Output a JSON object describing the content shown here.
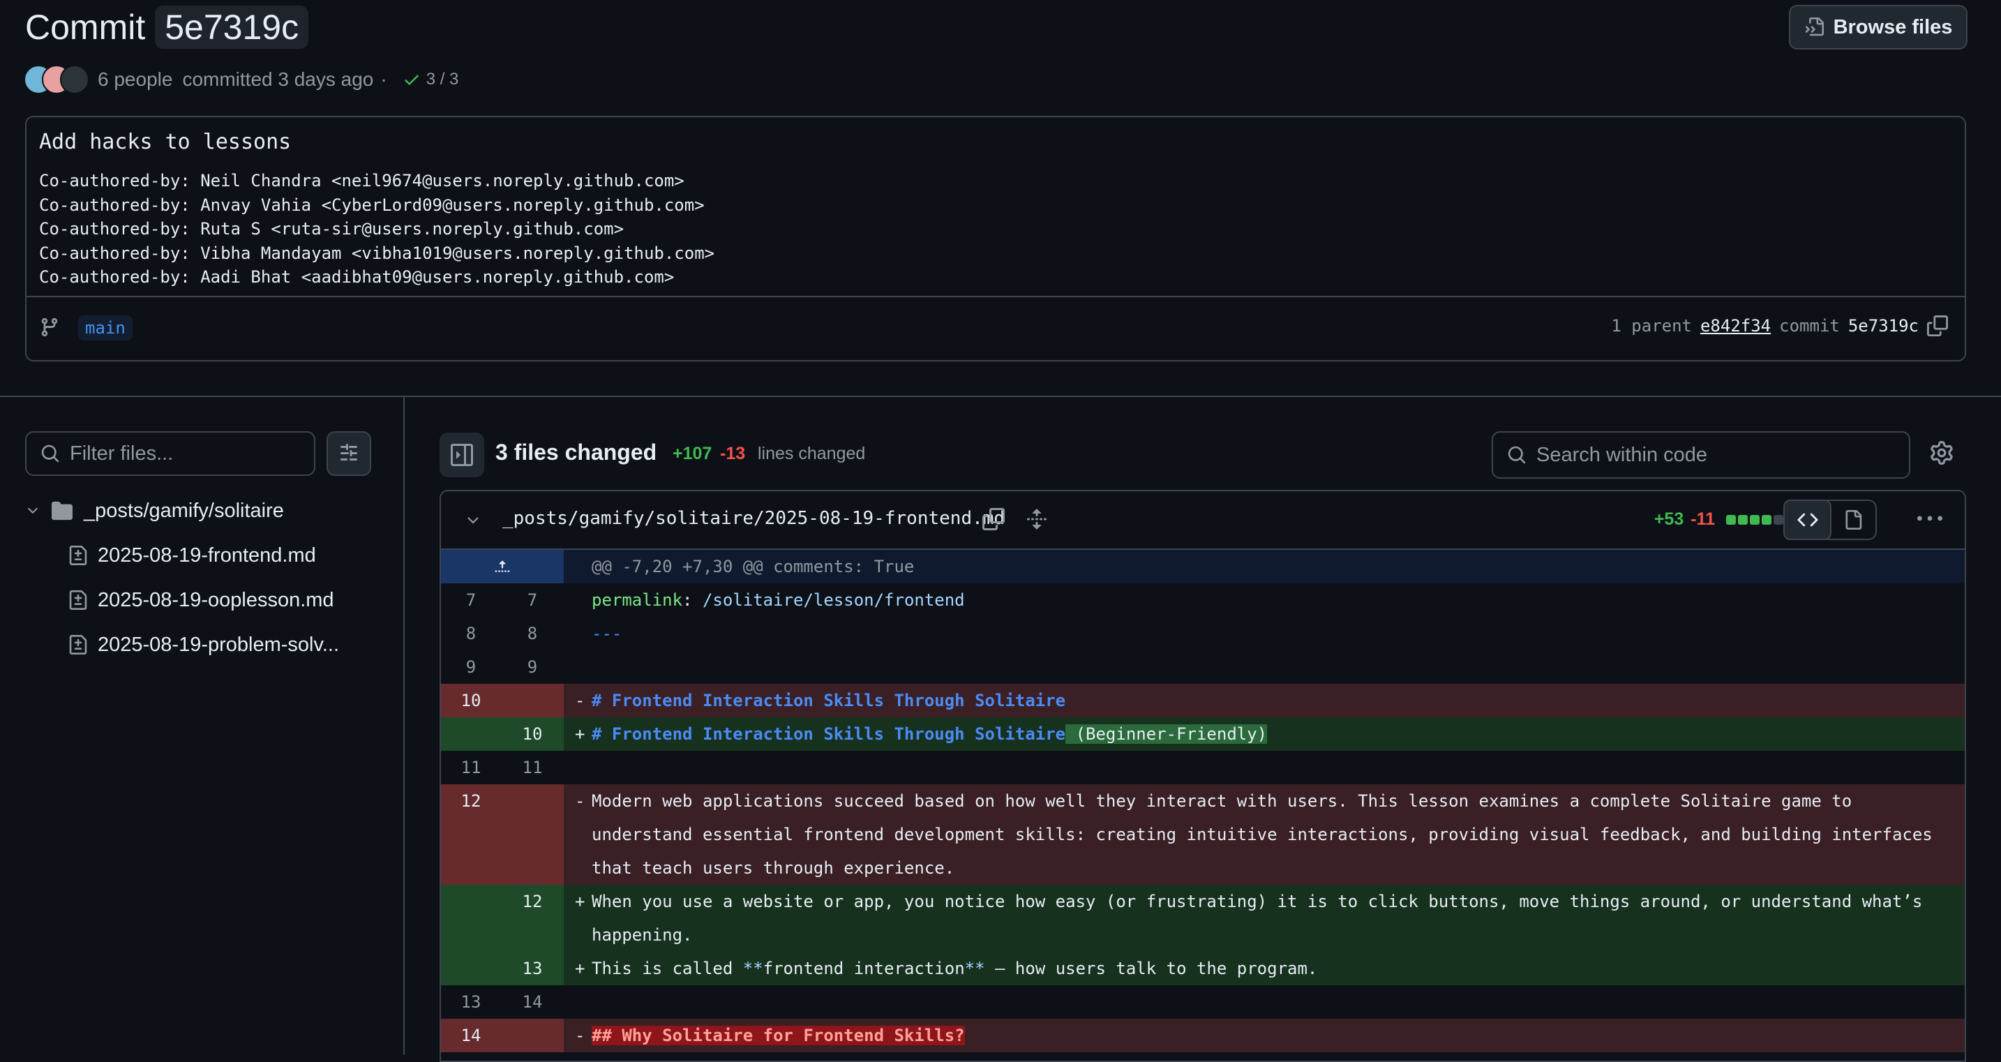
{
  "commit": {
    "title_prefix": "Commit",
    "sha": "5e7319c",
    "browse_label": "Browse files",
    "people": "6 people",
    "committed": "committed 3 days ago",
    "separator": "·",
    "checks": "3 / 3",
    "message_title": "Add hacks to lessons",
    "message_body": "Co-authored-by: Neil Chandra <neil9674@users.noreply.github.com>\nCo-authored-by: Anvay Vahia <CyberLord09@users.noreply.github.com>\nCo-authored-by: Ruta S <ruta-sir@users.noreply.github.com>\nCo-authored-by: Vibha Mandayam <vibha1019@users.noreply.github.com>\nCo-authored-by: Aadi Bhat <aadibhat09@users.noreply.github.com>",
    "branch": "main",
    "parent_label": "1 parent",
    "parent_sha": "e842f34",
    "commit_label": "commit",
    "commit_sha": "5e7319c"
  },
  "sidebar": {
    "filter_placeholder": "Filter files...",
    "folder": "_posts/gamify/solitaire",
    "files": [
      "2025-08-19-frontend.md",
      "2025-08-19-ooplesson.md",
      "2025-08-19-problem-solv..."
    ]
  },
  "summary": {
    "files_changed": "3 files changed",
    "additions": "+107",
    "deletions": "-13",
    "lines_changed": "lines changed",
    "search_placeholder": "Search within code"
  },
  "file": {
    "path": "_posts/gamify/solitaire/2025-08-19-frontend.md",
    "additions": "+53",
    "deletions": "-11"
  },
  "diff": {
    "hunk": "@@ -7,20 +7,30 @@ comments: True",
    "r7_old": "7",
    "r7_new": "7",
    "r7_key": "permalink",
    "r7_colon": ": ",
    "r7_val": "/solitaire/lesson/frontend",
    "r8_old": "8",
    "r8_new": "8",
    "r8_code": "---",
    "r9_old": "9",
    "r9_new": "9",
    "r10d_old": "10",
    "r10d_sign": "-",
    "r10d_code": "# Frontend Interaction Skills Through Solitaire",
    "r10a_new": "10",
    "r10a_sign": "+",
    "r10a_code": "# Frontend Interaction Skills Through Solitaire",
    "r10a_hl": " (Beginner-Friendly)",
    "r11_old": "11",
    "r11_new": "11",
    "r12d_old": "12",
    "r12d_sign": "-",
    "r12d_code": "Modern web applications succeed based on how well they interact with users. This lesson examines a complete Solitaire game to understand essential frontend development skills: creating intuitive interactions, providing visual feedback, and building interfaces that teach users through experience.",
    "r12a_new": "12",
    "r12a_sign": "+",
    "r12a_code": "When you use a website or app, you notice how easy (or frustrating) it is to click buttons, move things around, or understand what’s happening.",
    "r13a_new": "13",
    "r13a_sign": "+",
    "r13a_pre": "This is called ",
    "r13a_b1": "**",
    "r13a_mid": "frontend interaction",
    "r13a_b2": "**",
    "r13a_post": " — how users talk to the program.",
    "r13_old": "13",
    "r13_new": "14",
    "r14d_old": "14",
    "r14d_sign": "-",
    "r14d_code": "## Why Solitaire for Frontend Skills?"
  },
  "colors": {
    "add": "#3fb950",
    "del": "#f85149",
    "accent": "#4493f8",
    "bg": "#0d1117"
  }
}
